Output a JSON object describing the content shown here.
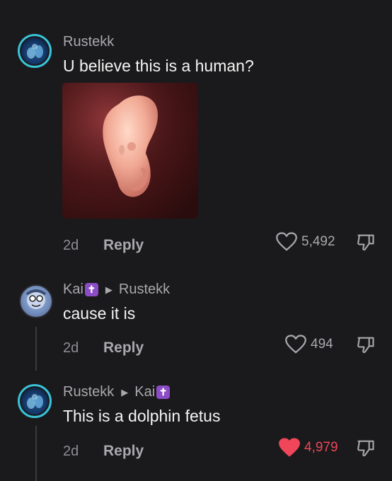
{
  "comments": [
    {
      "author": "Rustekk",
      "text": "U believe this is a human?",
      "age": "2d",
      "reply_label": "Reply",
      "likes": "5,492",
      "liked": false,
      "has_image": true
    },
    {
      "author": "Kai",
      "author_badge": "✝",
      "reply_to": "Rustekk",
      "text": "cause it is",
      "age": "2d",
      "reply_label": "Reply",
      "likes": "494",
      "liked": false
    },
    {
      "author": "Rustekk",
      "reply_to": "Kai",
      "reply_to_badge": "✝",
      "text": "This is a dolphin fetus",
      "age": "2d",
      "reply_label": "Reply",
      "likes": "4,979",
      "liked": true
    }
  ],
  "colors": {
    "background": "#1a1a1c",
    "liked_heart": "#ef4659",
    "badge_purple": "#8b4cc6",
    "avatar_ring": "#39c2d8"
  },
  "icons": {
    "like": "heart-icon",
    "liked": "heart-filled-icon",
    "dislike": "thumbs-down-icon",
    "reply_caret": "caret-right-icon",
    "badge": "latin-cross-icon"
  }
}
